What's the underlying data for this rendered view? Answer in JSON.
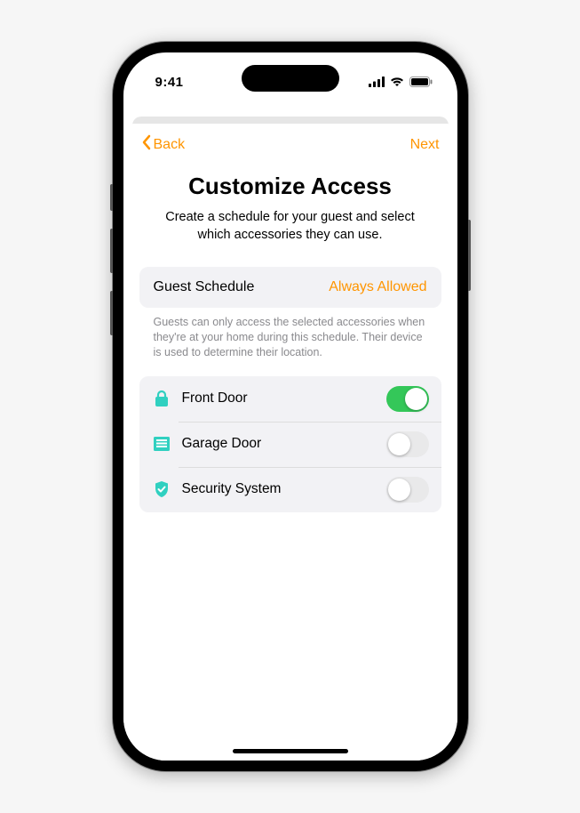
{
  "status": {
    "time": "9:41"
  },
  "nav": {
    "back_label": "Back",
    "next_label": "Next"
  },
  "header": {
    "title": "Customize Access",
    "subtitle": "Create a schedule for your guest and select which accessories they can use."
  },
  "schedule": {
    "label": "Guest Schedule",
    "value": "Always Allowed",
    "helper": "Guests can only access the selected accessories when they're at your home during this schedule. Their device is used to determine their location."
  },
  "accessories": [
    {
      "label": "Front Door",
      "icon": "lock-icon",
      "on": true
    },
    {
      "label": "Garage Door",
      "icon": "garage-icon",
      "on": false
    },
    {
      "label": "Security System",
      "icon": "shield-check-icon",
      "on": false
    }
  ],
  "colors": {
    "accent": "#ff9500",
    "accessory_icon": "#30d0c0",
    "toggle_on": "#34c759"
  }
}
